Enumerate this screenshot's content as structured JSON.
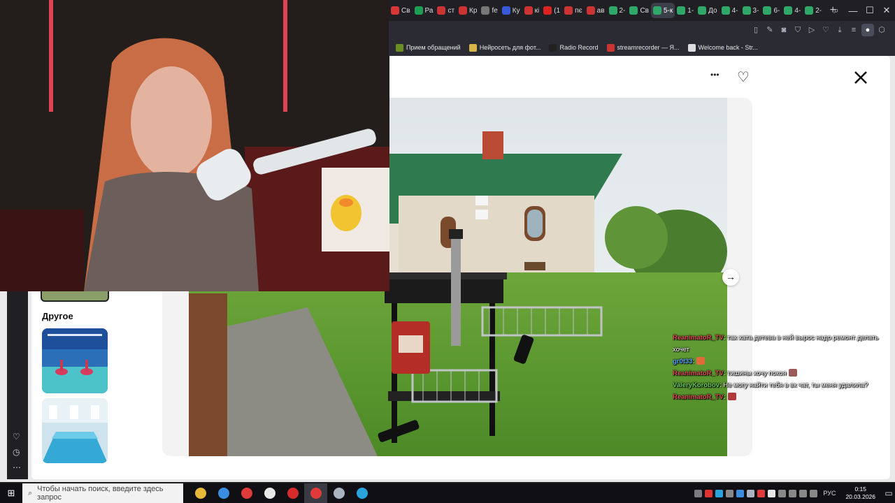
{
  "browser": {
    "tabs": [
      {
        "label": "Св",
        "color": "#d93636"
      },
      {
        "label": "Ра",
        "color": "#1d9e55"
      },
      {
        "label": "ст",
        "color": "#cc3333"
      },
      {
        "label": "Кр",
        "color": "#cc3333"
      },
      {
        "label": "fe",
        "color": "#777777"
      },
      {
        "label": "Ку",
        "color": "#3a5bd9"
      },
      {
        "label": "кі",
        "color": "#cc3333"
      },
      {
        "label": "(1",
        "color": "#dd2222"
      },
      {
        "label": "пє",
        "color": "#cc3333"
      },
      {
        "label": "ав",
        "color": "#cc3333"
      },
      {
        "label": "2-",
        "color": "#2fa86a"
      },
      {
        "label": "Св",
        "color": "#2fa86a"
      },
      {
        "label": "5-к",
        "color": "#2fa86a",
        "active": true
      },
      {
        "label": "1-",
        "color": "#2fa86a"
      },
      {
        "label": "До",
        "color": "#2fa86a"
      },
      {
        "label": "4-",
        "color": "#2fa86a"
      },
      {
        "label": "3-",
        "color": "#2fa86a"
      },
      {
        "label": "6-",
        "color": "#2fa86a"
      },
      {
        "label": "4-",
        "color": "#2fa86a"
      },
      {
        "label": "2-",
        "color": "#2fa86a"
      }
    ],
    "new_tab": "+",
    "window_controls": {
      "search": "⌕",
      "minimize": "—",
      "maximize": "☐",
      "close": "✕"
    },
    "bookmarks": [
      {
        "label": "Прием обращений",
        "color": "#6b8e23"
      },
      {
        "label": "Нейросеть для фот...",
        "color": "#d9b44a"
      },
      {
        "label": "Radio Record",
        "color": "#222222"
      },
      {
        "label": "streamrecorder — Я...",
        "color": "#cc3333"
      },
      {
        "label": "Welcome back - Str...",
        "color": "#dddddd"
      }
    ]
  },
  "viewer": {
    "more_icon": "•••",
    "favorite_icon": "♡",
    "close_icon": "✕",
    "next_icon": "→"
  },
  "sidebar": {
    "section_title": "Другое"
  },
  "chat": {
    "messages": [
      {
        "user": "ReanimatoR_TV",
        "user_class": "u1",
        "text": ": так хата детева в ней вырос надо ремонт делать",
        "cont": "хочет"
      },
      {
        "user": "gr0t33",
        "user_class": "u2",
        "text": ":",
        "emote": "#e06a3a"
      },
      {
        "user": "ReanimatoR_TV",
        "user_class": "u1",
        "text": ": тишины хочу покоя",
        "emote": "#9a5a5a"
      },
      {
        "user": "ValeryKorobov",
        "user_class": "u3",
        "text": ": Не могу найти тебя в вк чат, ты меня удалила?"
      },
      {
        "user": "ReanimatoR_TV",
        "user_class": "u1",
        "text": ":",
        "emote": "#b03a3a"
      }
    ]
  },
  "taskbar": {
    "start_icon": "⊞",
    "search_placeholder": "Чтобы начать поиск, введите здесь запрос",
    "apps": [
      {
        "name": "file-explorer",
        "color": "#e8b83a"
      },
      {
        "name": "store",
        "color": "#3b8de0"
      },
      {
        "name": "yandex",
        "color": "#e03a3a"
      },
      {
        "name": "yandex-browser",
        "color": "#e8e8e8"
      },
      {
        "name": "opera",
        "color": "#d62b2b"
      },
      {
        "name": "opera-gx",
        "color": "#e03a3a",
        "active": true
      },
      {
        "name": "steam",
        "color": "#aab4c0"
      },
      {
        "name": "telegram",
        "color": "#2aa3dd"
      }
    ],
    "lang": "РУС",
    "time": "0:15",
    "date": "20.03.2026"
  }
}
